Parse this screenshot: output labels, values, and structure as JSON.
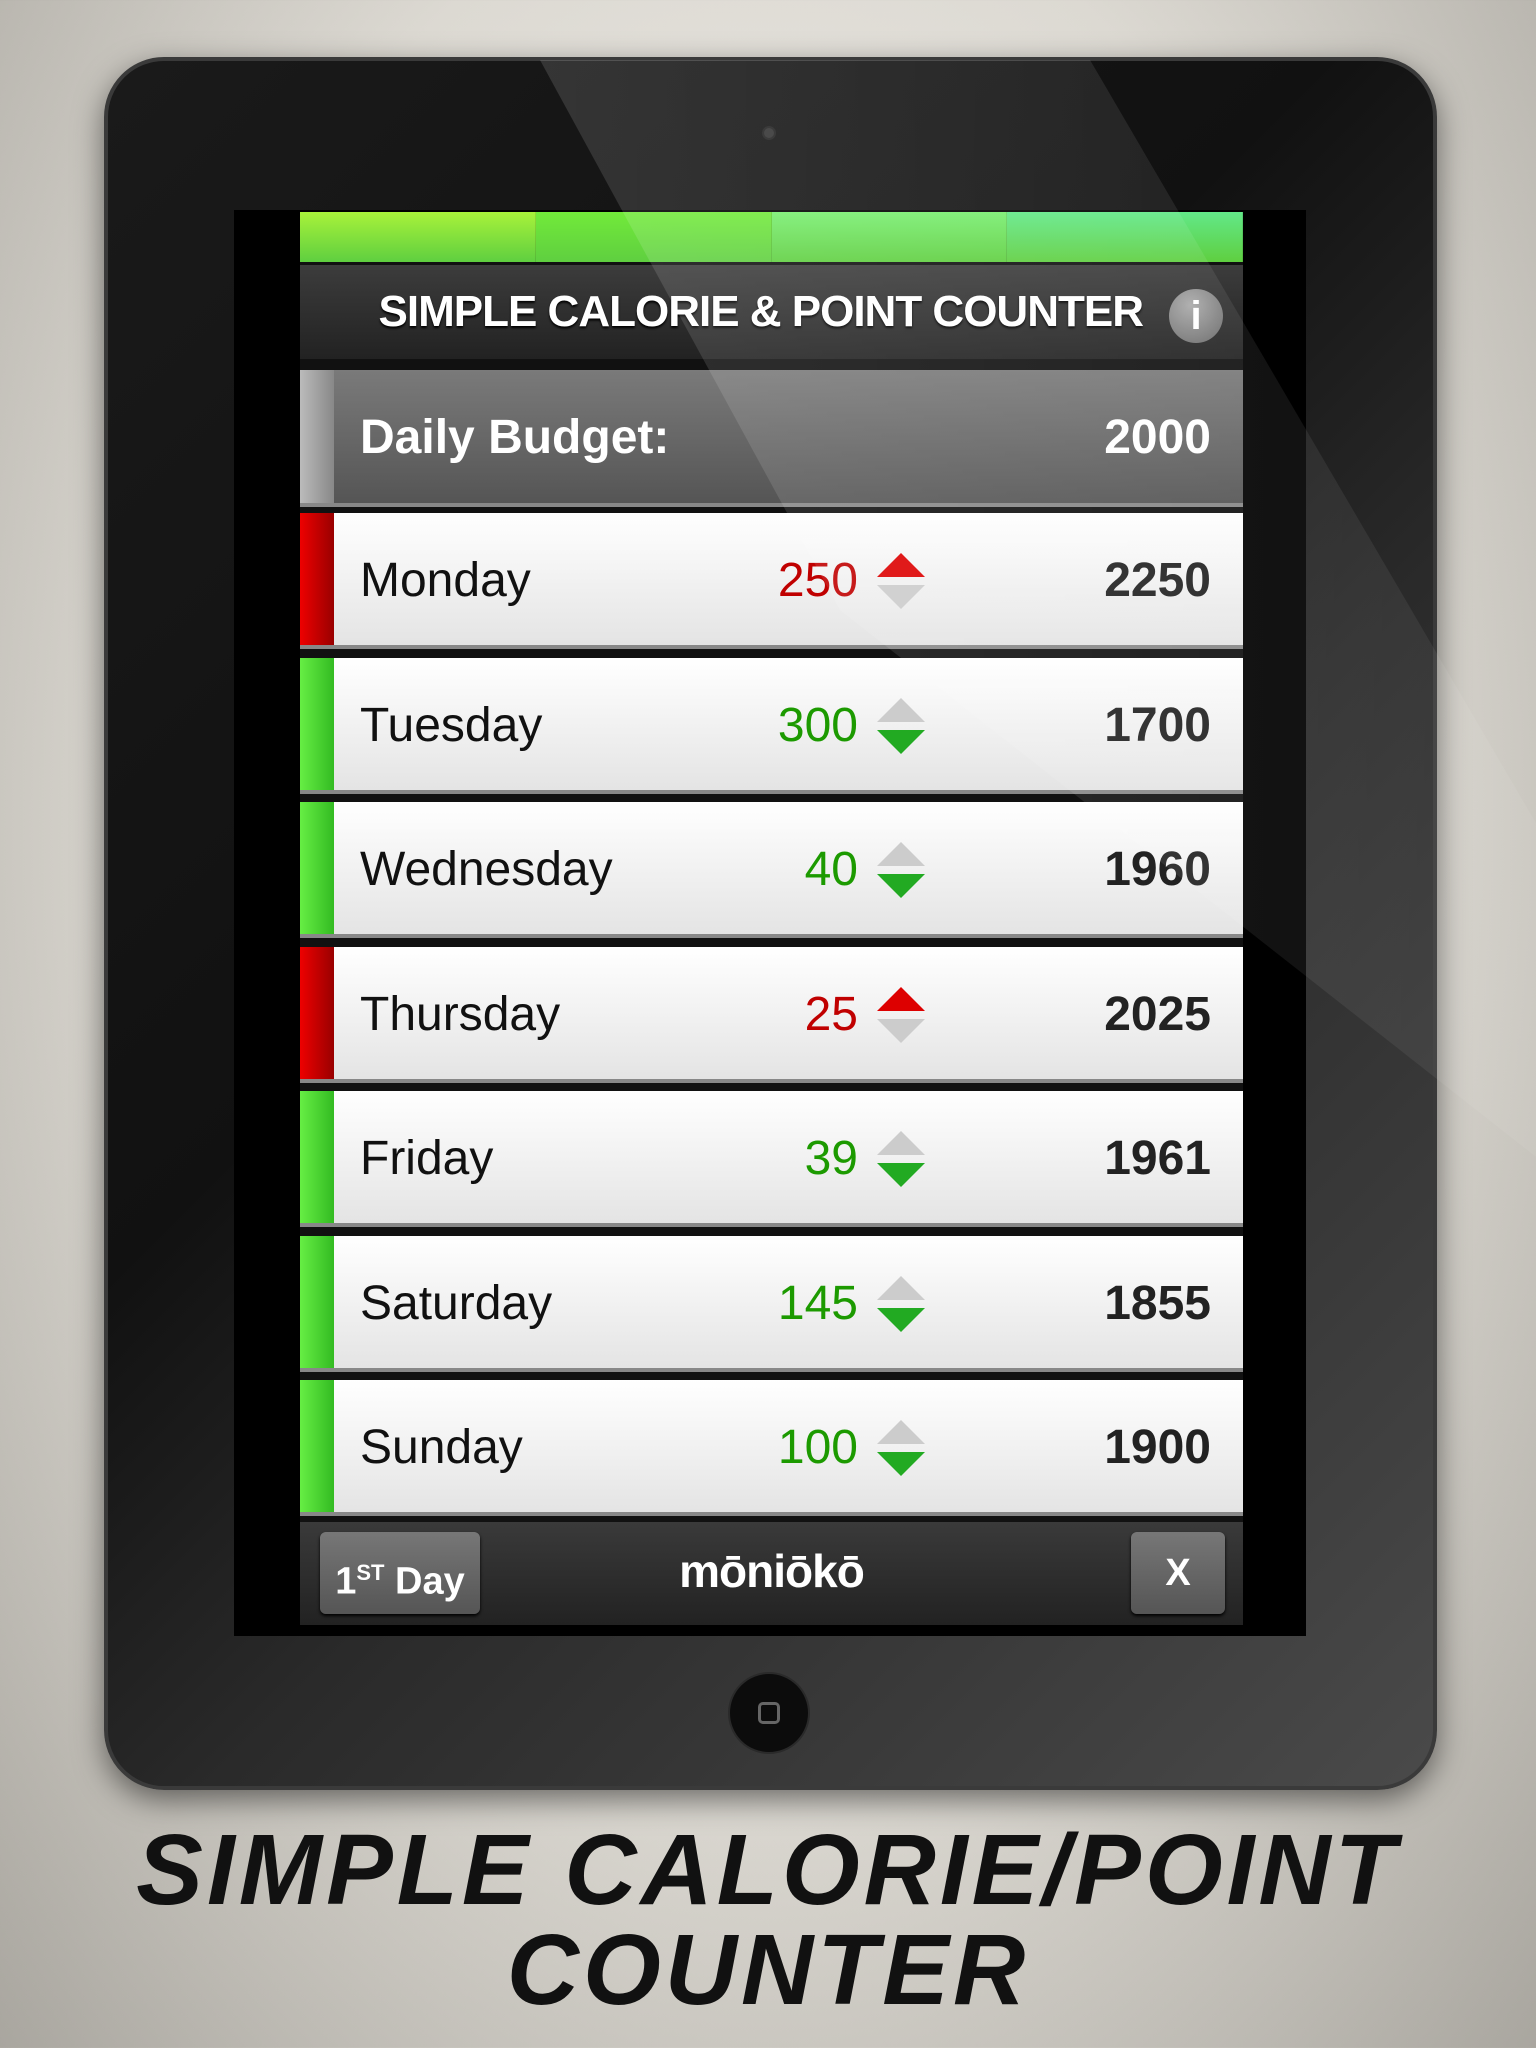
{
  "app": {
    "title": "SIMPLE CALORIE & POINT COUNTER",
    "info_icon": "info-icon",
    "info_label": "i",
    "green_segments": [
      "#a8f23a",
      "#72ea3a",
      "#78ee70",
      "#62e888"
    ]
  },
  "budget": {
    "label": "Daily Budget:",
    "value": "2000"
  },
  "days": [
    {
      "name": "Monday",
      "change": "250",
      "direction": "up",
      "total": "2250",
      "color": "#c00000"
    },
    {
      "name": "Tuesday",
      "change": "300",
      "direction": "down",
      "total": "1700",
      "color": "#1c9a00"
    },
    {
      "name": "Wednesday",
      "change": "40",
      "direction": "down",
      "total": "1960",
      "color": "#1c9a00"
    },
    {
      "name": "Thursday",
      "change": "25",
      "direction": "up",
      "total": "2025",
      "color": "#c00000"
    },
    {
      "name": "Friday",
      "change": "39",
      "direction": "down",
      "total": "1961",
      "color": "#1c9a00"
    },
    {
      "name": "Saturday",
      "change": "145",
      "direction": "down",
      "total": "1855",
      "color": "#1c9a00"
    },
    {
      "name": "Sunday",
      "change": "100",
      "direction": "down",
      "total": "1900",
      "color": "#1c9a00"
    }
  ],
  "footer": {
    "first_day_num": "1",
    "first_day_sup": "ST",
    "first_day_word": " Day",
    "logo": "mōniōkō",
    "close_label": "X"
  },
  "caption": {
    "line1": "SIMPLE CALORIE/POINT",
    "line2": "COUNTER"
  }
}
